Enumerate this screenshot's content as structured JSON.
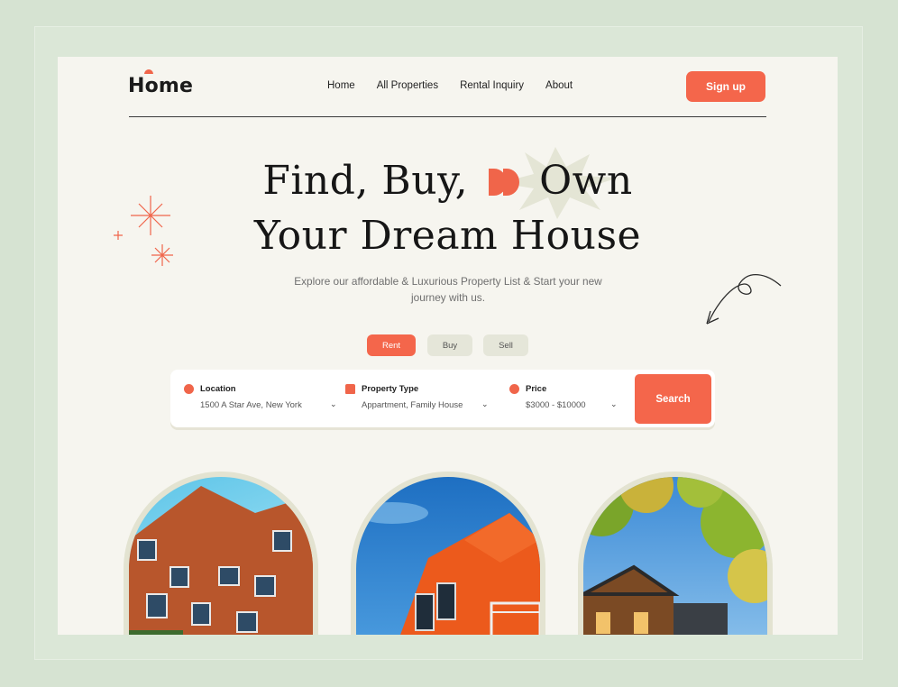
{
  "brand": {
    "logo_text": "Home"
  },
  "nav": {
    "items": [
      "Home",
      "All Properties",
      "Rental Inquiry",
      "About"
    ],
    "signup_label": "Sign up"
  },
  "hero": {
    "line1_part1": "Find, Buy,",
    "line1_part2": "Own",
    "line2": "Your Dream House",
    "subtitle": "Explore our affordable & Luxurious Property List & Start your new journey with us."
  },
  "tabs": [
    "Rent",
    "Buy",
    "Sell"
  ],
  "search": {
    "location_label": "Location",
    "location_value": "1500 A Star Ave, New York",
    "type_label": "Property Type",
    "type_value": "Appartment, Family House",
    "price_label": "Price",
    "price_value": "$3000 - $10000",
    "button_label": "Search"
  },
  "colors": {
    "accent": "#f4664b",
    "background": "#f6f5ef",
    "frame": "#d6e3d2"
  },
  "icons": [
    "pin-icon",
    "house-icon",
    "dollar-icon",
    "chevron-down-icon",
    "sparkle-icon",
    "curly-arrow-icon",
    "starburst-icon"
  ]
}
